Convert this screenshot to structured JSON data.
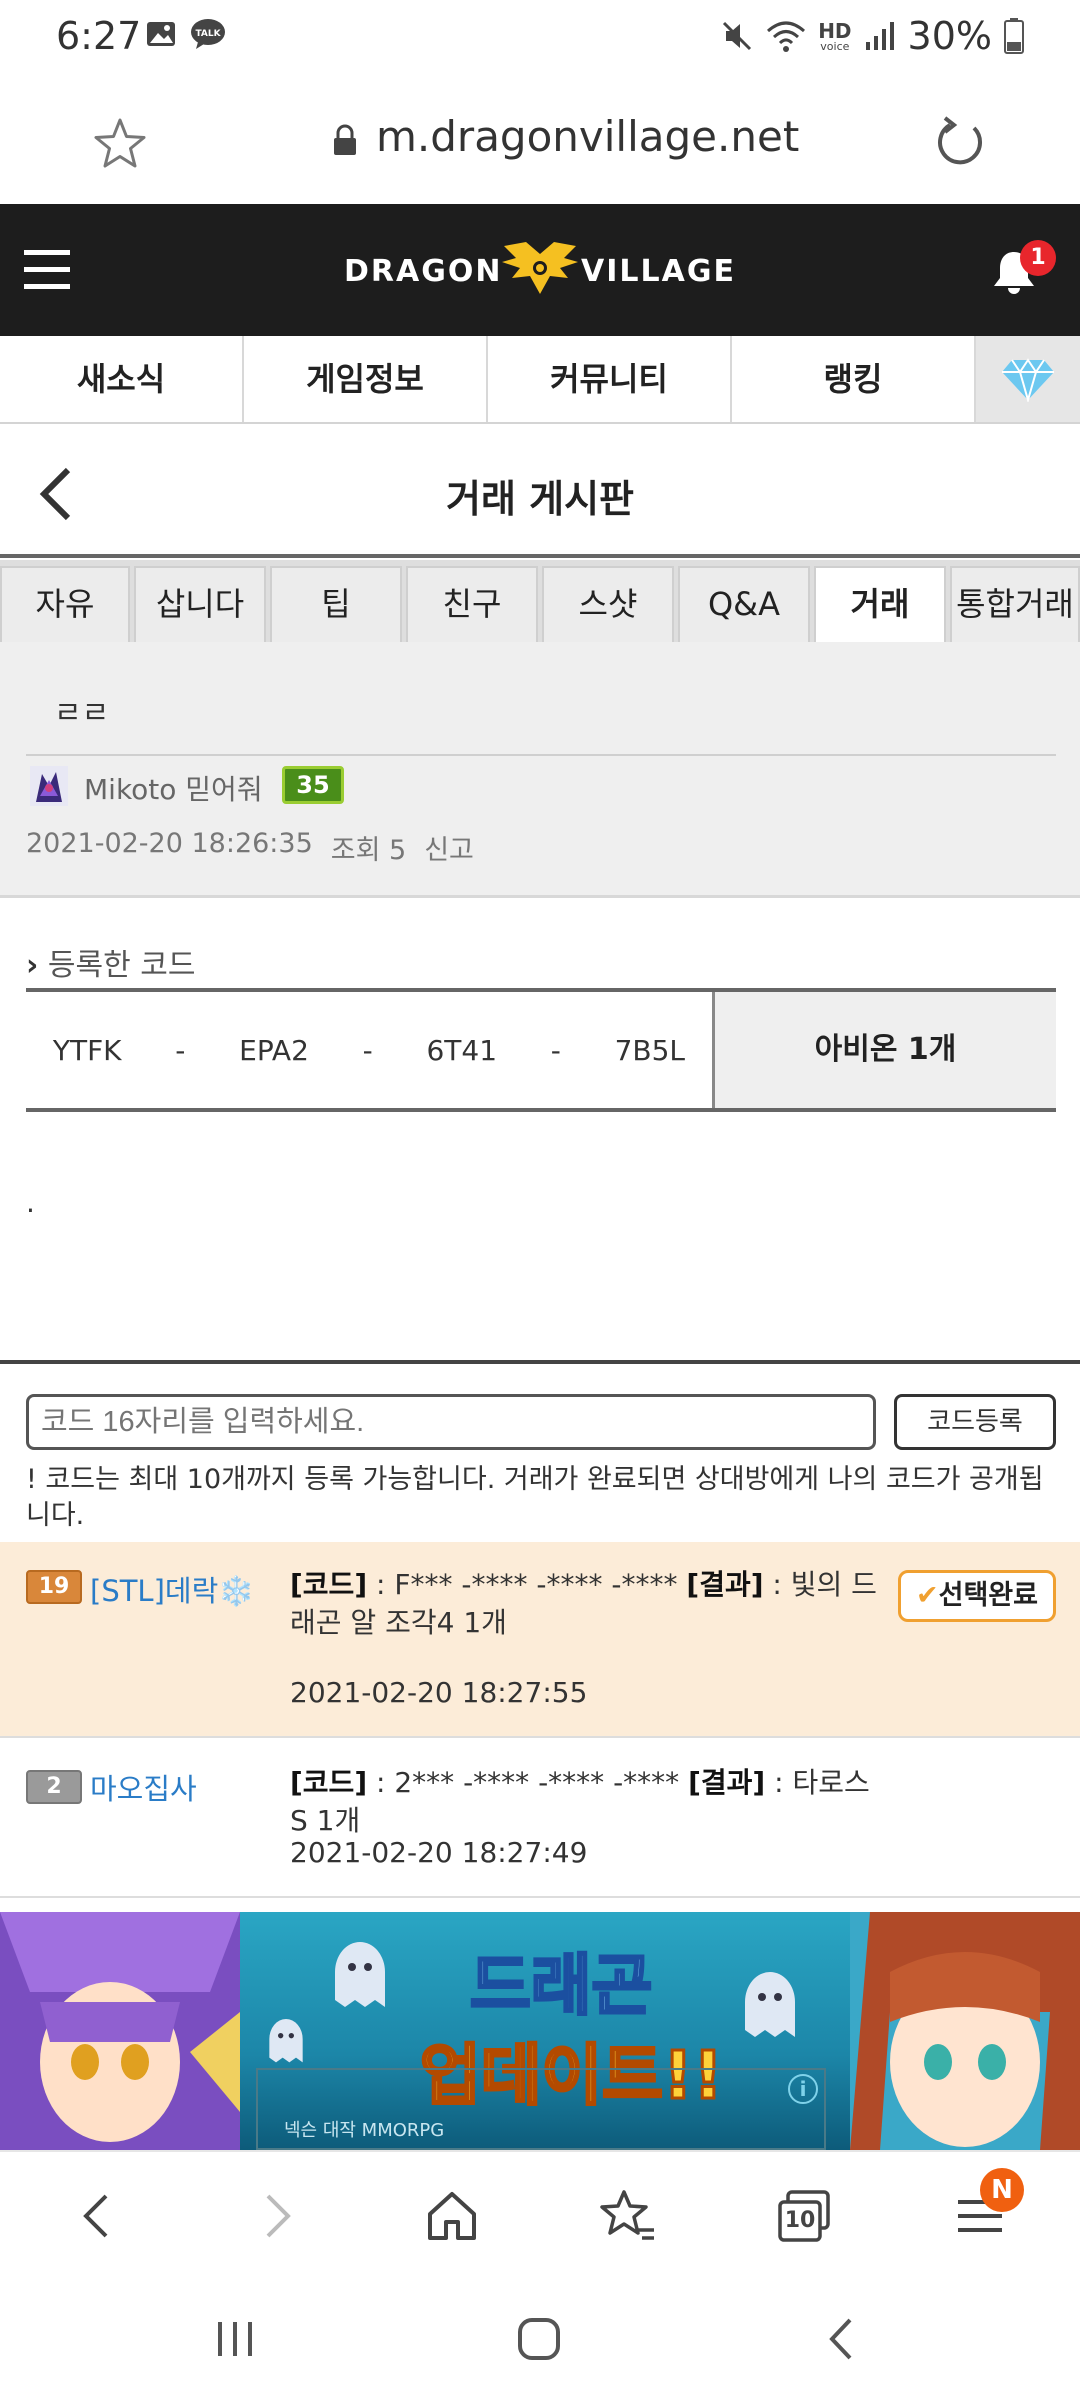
{
  "status_bar": {
    "time": "6:27",
    "talk_label": "TALK",
    "hd_label": "HD",
    "voice_label": "voice",
    "battery": "30%"
  },
  "url_bar": {
    "url": "m.dragonvillage.net"
  },
  "site_header": {
    "logo_left": "DRAGON",
    "logo_right": "VILLAGE",
    "notification_count": "1"
  },
  "main_nav": {
    "items": [
      {
        "label": "새소식"
      },
      {
        "label": "게임정보"
      },
      {
        "label": "커뮤니티"
      },
      {
        "label": "랭킹"
      }
    ]
  },
  "board": {
    "title": "거래 게시판",
    "tabs": [
      {
        "label": "자유"
      },
      {
        "label": "삽니다"
      },
      {
        "label": "팁"
      },
      {
        "label": "친구"
      },
      {
        "label": "스샷"
      },
      {
        "label": "Q&A"
      },
      {
        "label": "거래"
      },
      {
        "label": "통합거래"
      }
    ]
  },
  "post": {
    "title": "ㄹㄹ",
    "author": "Mikoto 믿어줘",
    "author_level": "35",
    "date": "2021-02-20 18:26:35",
    "views": "조회 5",
    "report": "신고",
    "body": "."
  },
  "registered_code": {
    "section_title": "등록한 코드",
    "parts": [
      "YTFK",
      "-",
      "EPA2",
      "-",
      "6T41",
      "-",
      "7B5L"
    ],
    "reward": "아비온 1개"
  },
  "code_input": {
    "placeholder": "코드 16자리를 입력하세요.",
    "register_button": "코드등록",
    "notice": "! 코드는 최대 10개까지 등록 가능합니다. 거래가 완료되면 상대방에게 나의 코드가 공개됩니다."
  },
  "code_entries": [
    {
      "level": "19",
      "user": "[STL]데락❄️",
      "code_label": "[코드]",
      "code": " : F*** -**** -**** -**** ",
      "result_label": "[결과]",
      "result": " : 빛의 드래곤 알 조각4 1개",
      "date": "2021-02-20 18:27:55",
      "selected_label": "선택완료"
    },
    {
      "level": "2",
      "user": "마오집사",
      "code_label": "[코드]",
      "code": " : 2*** -**** -**** -**** ",
      "result_label": "[결과]",
      "result": " : 타로스 S 1개",
      "date": "2021-02-20 18:27:49"
    }
  ],
  "ad": {
    "title_line1": "드래곤",
    "title_line2": "업데이트!!",
    "small_text": "넥슨 대작 MMORPG",
    "info_icon": "i"
  },
  "browser_bar": {
    "tab_count": "10",
    "menu_badge": "N"
  }
}
